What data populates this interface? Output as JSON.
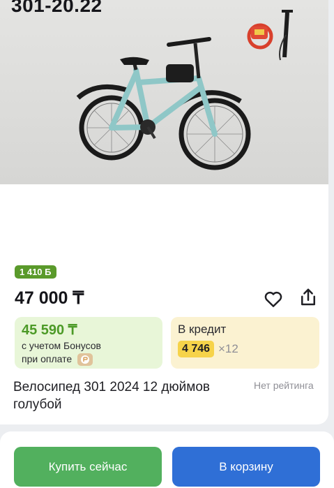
{
  "product": {
    "model_label": "301-20.22",
    "name": "Велосипед 301 2024 12 дюймов голубой",
    "rating": "Нет рейтинга"
  },
  "bonus_badge": "1 410 Б",
  "price": "47 000 ₸",
  "bonus_box": {
    "price": "45 590 ₸",
    "line1": "с учетом Бонусов",
    "line2": "при оплате"
  },
  "credit_box": {
    "label": "В кредит",
    "amount": "4 746",
    "months": "×12"
  },
  "actions": {
    "buy_now": "Купить сейчас",
    "add_to_cart": "В корзину"
  },
  "icons": {
    "favorite": "heart-icon",
    "share": "share-icon",
    "payment": "payment-service-icon"
  },
  "colors": {
    "bonus_green": "#5a9a2b",
    "buy_button": "#52b05e",
    "cart_button": "#2f6fd6",
    "credit_highlight": "#f6d34a"
  }
}
